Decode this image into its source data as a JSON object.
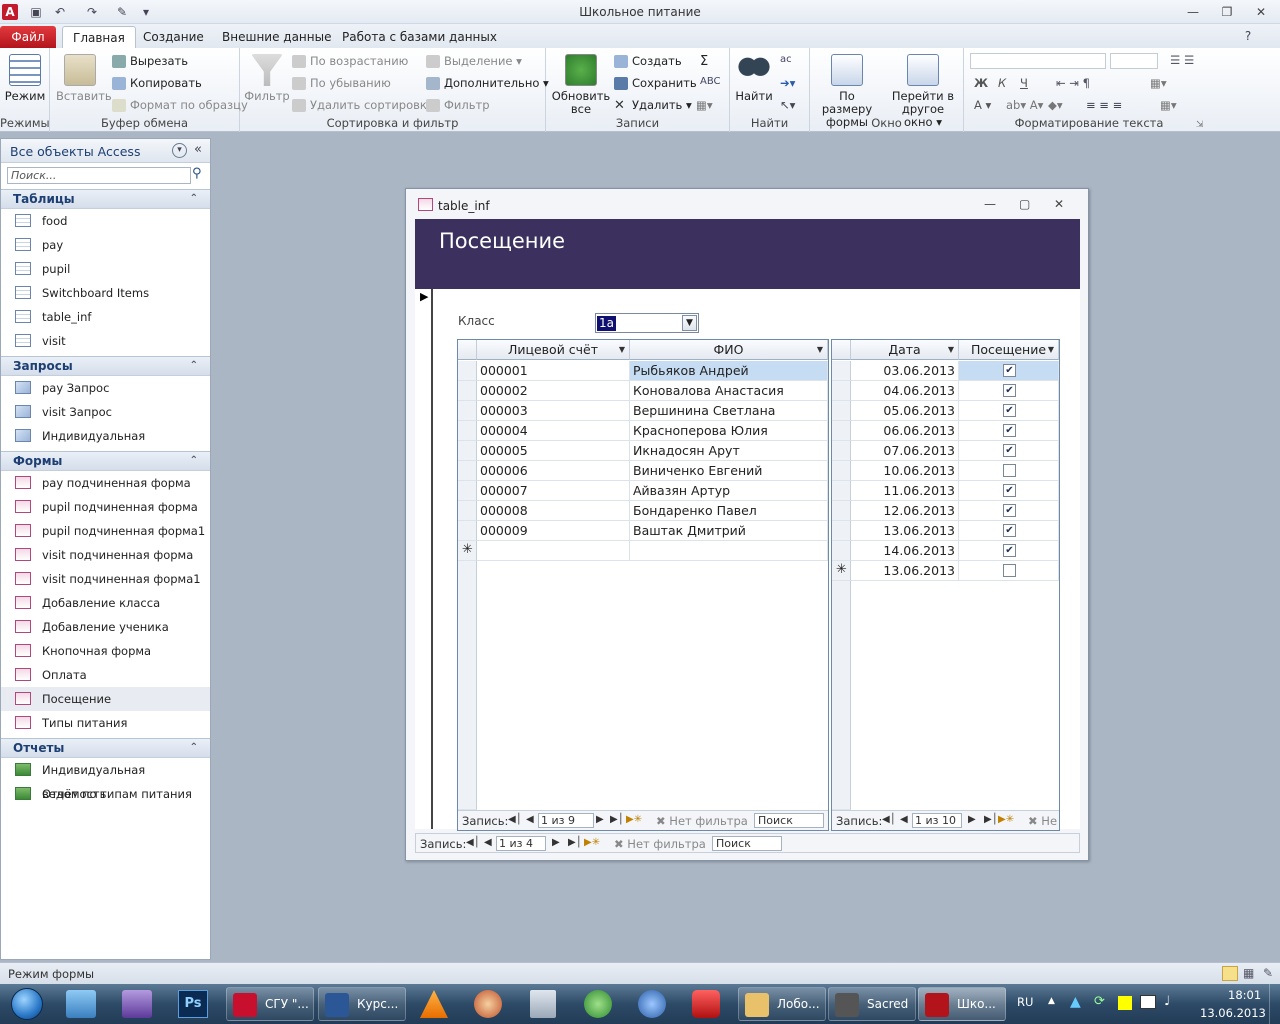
{
  "app": {
    "title": "Школьное питание"
  },
  "tabs": [
    "Файл",
    "Главная",
    "Создание",
    "Внешние данные",
    "Работа с базами данных"
  ],
  "ribbon": {
    "groups": [
      "Режимы",
      "Буфер обмена",
      "Сортировка и фильтр",
      "Записи",
      "Найти",
      "Окно",
      "Форматирование текста"
    ],
    "mode": "Режим",
    "paste": "Вставить",
    "cut": "Вырезать",
    "copy": "Копировать",
    "format_painter": "Формат по образцу",
    "filter": "Фильтр",
    "asc": "По возрастанию",
    "desc": "По убыванию",
    "clear_sort": "Удалить сортировку",
    "selection": "Выделение",
    "advanced": "Дополнительно",
    "toggle_filter": "Фильтр",
    "refresh": "Обновить все",
    "new": "Создать",
    "save": "Сохранить",
    "delete": "Удалить",
    "find": "Найти",
    "fit_form": "По размеру формы",
    "switch_window": "Перейти в другое окно"
  },
  "nav": {
    "title": "Все объекты Access",
    "search_placeholder": "Поиск...",
    "sections": [
      {
        "title": "Таблицы",
        "items": [
          "food",
          "pay",
          "pupil",
          "Switchboard Items",
          "table_inf",
          "visit"
        ]
      },
      {
        "title": "Запросы",
        "items": [
          "pay Запрос",
          "visit Запрос",
          "Индивидуальная ведомость"
        ]
      },
      {
        "title": "Формы",
        "items": [
          "pay подчиненная форма",
          "pupil подчиненная форма",
          "pupil подчиненная форма1",
          "visit подчиненная форма",
          "visit подчиненная форма1",
          "Добавление класса",
          "Добавление ученика",
          "Кнопочная форма",
          "Оплата",
          "Посещение",
          "Типы питания"
        ]
      },
      {
        "title": "Отчеты",
        "items": [
          "Индивидуальная ведомость",
          "Отчёт по типам питания"
        ]
      }
    ]
  },
  "form": {
    "window_title": "table_inf",
    "header": "Посещение",
    "class_label": "Класс",
    "class_value": "1а",
    "pupils": {
      "columns": [
        "Лицевой счёт",
        "ФИО"
      ],
      "rows": [
        [
          "000001",
          "Рыбьяков Андрей"
        ],
        [
          "000002",
          "Коновалова Анастасия"
        ],
        [
          "000003",
          "Вершинина Светлана"
        ],
        [
          "000004",
          "Красноперова Юлия"
        ],
        [
          "000005",
          "Икнадосян Арут"
        ],
        [
          "000006",
          "Виниченко Евгений"
        ],
        [
          "000007",
          "Айвазян Артур"
        ],
        [
          "000008",
          "Бондаренко Павел"
        ],
        [
          "000009",
          "Ваштак Дмитрий"
        ]
      ],
      "nav": {
        "label": "Запись:",
        "counter": "1 из 9",
        "filter": "Нет фильтра",
        "search": "Поиск"
      }
    },
    "visits": {
      "columns": [
        "Дата",
        "Посещение"
      ],
      "rows": [
        {
          "date": "03.06.2013",
          "checked": true
        },
        {
          "date": "04.06.2013",
          "checked": true
        },
        {
          "date": "05.06.2013",
          "checked": true
        },
        {
          "date": "06.06.2013",
          "checked": true
        },
        {
          "date": "07.06.2013",
          "checked": true
        },
        {
          "date": "10.06.2013",
          "checked": false
        },
        {
          "date": "11.06.2013",
          "checked": true
        },
        {
          "date": "12.06.2013",
          "checked": true
        },
        {
          "date": "13.06.2013",
          "checked": true
        },
        {
          "date": "14.06.2013",
          "checked": true
        }
      ],
      "new_row_date": "13.06.2013",
      "nav": {
        "label": "Запись:",
        "counter": "1 из 10",
        "filter": "Не"
      }
    },
    "nav": {
      "label": "Запись:",
      "counter": "1 из 4",
      "filter": "Нет фильтра",
      "search": "Поиск"
    }
  },
  "status": {
    "text": "Режим формы"
  },
  "taskbar": {
    "items": [
      {
        "label": "СГУ \"...",
        "icon": "opera-icon"
      },
      {
        "label": "Курс...",
        "icon": "word-icon"
      },
      {
        "label": "Лобо...",
        "icon": "folder-icon"
      },
      {
        "label": "Sacred",
        "icon": "sacred-icon"
      },
      {
        "label": "Шко...",
        "icon": "access-icon"
      }
    ],
    "lang": "RU",
    "time": "18:01",
    "date": "13.06.2013"
  },
  "colors": {
    "header": "#3b305e",
    "access_red": "#b3141c",
    "selection": "#c5dcf2"
  }
}
